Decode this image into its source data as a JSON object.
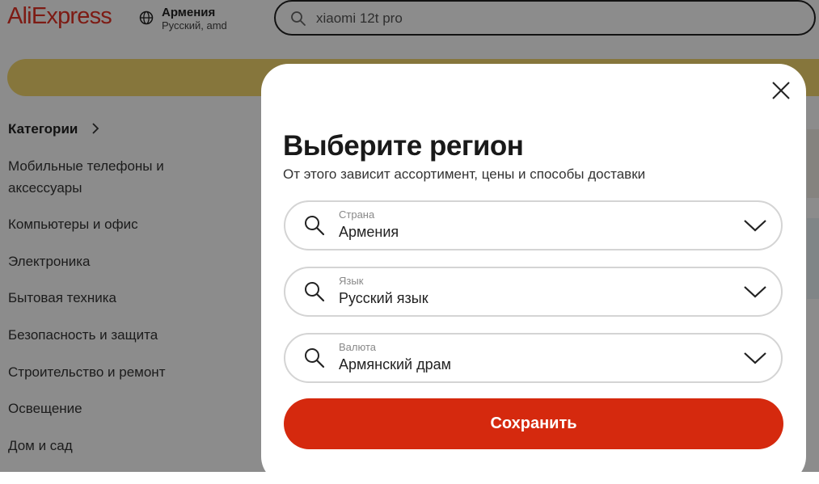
{
  "header": {
    "logo": "AliExpress",
    "region_country": "Армения",
    "region_language_currency": "Русский, amd",
    "search_value": "xiaomi 12t pro"
  },
  "categories": {
    "title": "Категории",
    "items": [
      "Мобильные телефоны и аксессуары",
      "Компьютеры и офис",
      "Электроника",
      "Бытовая техника",
      "Безопасность и защита",
      "Строительство и ремонт",
      "Освещение",
      "Дом и сад"
    ]
  },
  "modal": {
    "title": "Выберите регион",
    "subtitle": "От этого зависит ассортимент, цены и способы доставки",
    "fields": [
      {
        "label": "Страна",
        "value": "Армения"
      },
      {
        "label": "Язык",
        "value": "Русский язык"
      },
      {
        "label": "Валюта",
        "value": "Армянский драм"
      }
    ],
    "save_label": "Сохранить"
  },
  "colors": {
    "brand": "#e43225",
    "save_button": "#d5290e",
    "banner": "#f5d76e"
  }
}
